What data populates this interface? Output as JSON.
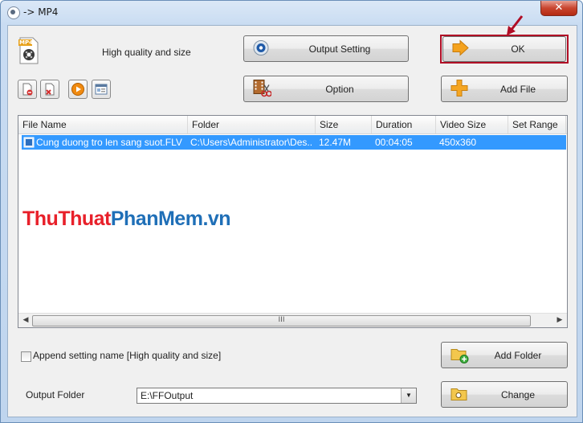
{
  "window": {
    "title": "-> MP4",
    "close_label": "✕"
  },
  "preset": {
    "badge": "MP4",
    "description": "High quality and size"
  },
  "buttons": {
    "output_setting": "Output Setting",
    "ok": "OK",
    "option": "Option",
    "add_file": "Add File",
    "add_folder": "Add Folder",
    "change": "Change"
  },
  "toolbar": {
    "icons": [
      "remove-file-icon",
      "clear-list-icon",
      "play-icon",
      "info-icon"
    ]
  },
  "file_list": {
    "columns": [
      "File Name",
      "Folder",
      "Size",
      "Duration",
      "Video Size",
      "Set Range"
    ],
    "rows": [
      {
        "name": "Cung duong tro len sang suot.FLV",
        "folder": "C:\\Users\\Administrator\\Des...",
        "size": "12.47M",
        "duration": "00:04:05",
        "video_size": "450x360",
        "range": ""
      }
    ],
    "scroll_grip": "III"
  },
  "watermark": {
    "part1": "ThuThuat",
    "part2": "PhanMem",
    "part3": ".vn"
  },
  "append_setting": {
    "label": "Append setting name [High quality and size]",
    "checked": false
  },
  "output_folder": {
    "label": "Output Folder",
    "value": "E:\\FFOutput"
  },
  "colors": {
    "highlight": "#b00d25",
    "selection": "#3399ff",
    "watermark_red": "#e8202a",
    "watermark_blue": "#1f6fb7"
  }
}
